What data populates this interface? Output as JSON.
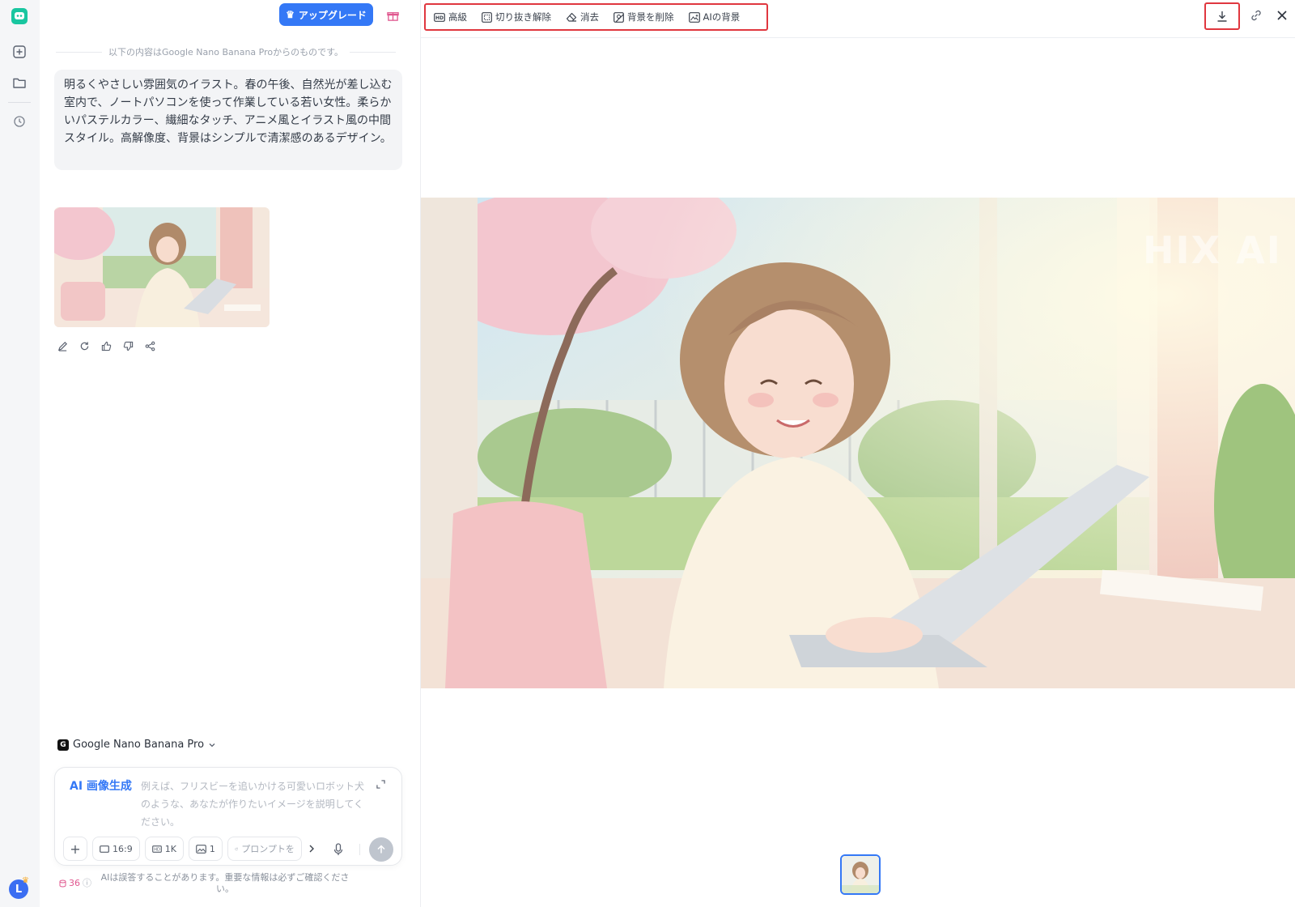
{
  "rail": {
    "icons": [
      "app-logo-icon",
      "new-chat-icon",
      "folder-icon",
      "history-icon"
    ],
    "avatar_letter": "L"
  },
  "chat": {
    "upgrade_label": "アップグレード",
    "source_note": "以下の内容はGoogle Nano Banana Proからのものです。",
    "prompt_text": "明るくやさしい雰囲気のイラスト。春の午後、自然光が差し込む室内で、ノートパソコンを使って作業している若い女性。柔らかいパステルカラー、繊細なタッチ、アニメ風とイラスト風の中間スタイル。高解像度、背景はシンプルで清潔感のあるデザイン。",
    "actions": [
      "edit-icon",
      "regenerate-icon",
      "thumbs-up-icon",
      "thumbs-down-icon",
      "share-icon"
    ],
    "model_name": "Google Nano Banana Pro",
    "composer": {
      "mode_label": "AI 画像生成",
      "placeholder": "例えば、フリスビーを追いかける可愛いロボット犬のような、あなたが作りたいイメージを説明してください。",
      "aspect": "16:9",
      "resolution": "1K",
      "count": "1",
      "prompt_chip": "プロンプトを"
    },
    "credits": "36",
    "disclaimer": "AIは誤答することがあります。重要な情報は必ずご確認ください。"
  },
  "viewer": {
    "tools": [
      {
        "label": "高級",
        "icon": "hd-icon"
      },
      {
        "label": "切り抜き解除",
        "icon": "uncrop-icon"
      },
      {
        "label": "消去",
        "icon": "eraser-icon"
      },
      {
        "label": "背景を削除",
        "icon": "remove-bg-icon"
      },
      {
        "label": "AIの背景",
        "icon": "ai-bg-icon"
      }
    ],
    "watermark": "HIX AI",
    "colors": {
      "highlight": "#e0373f",
      "accent": "#3478f6"
    }
  }
}
